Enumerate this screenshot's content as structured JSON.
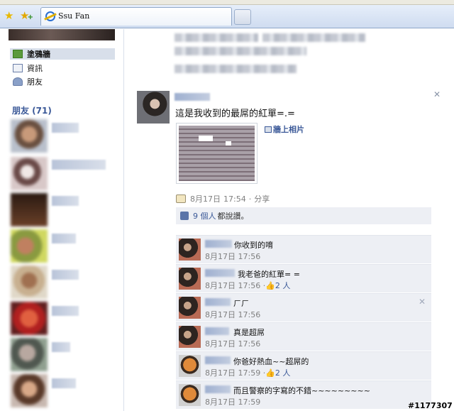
{
  "browser": {
    "tab_title": "Ssu Fan"
  },
  "sidebar": {
    "items": [
      {
        "label": "塗鴉牆"
      },
      {
        "label": "資訊"
      },
      {
        "label": "朋友"
      }
    ],
    "friends_heading": "朋友 (71)"
  },
  "post": {
    "text": "這是我收到的最屌的紅單=.=",
    "photo_link": "牆上相片",
    "date": "8月17日",
    "time": "17:54",
    "separator": "·",
    "share": "分享",
    "likes_count": "9 個人",
    "likes_suffix": "都說讚。"
  },
  "comments": [
    {
      "text": "你收到的唷",
      "date": "8月17日",
      "time": "17:56",
      "likes": ""
    },
    {
      "text": "我老爸的紅單= =",
      "date": "8月17日",
      "time": "17:56",
      "likes": "2 人"
    },
    {
      "text": "ㄏㄏ",
      "date": "8月17日",
      "time": "17:56",
      "likes": ""
    },
    {
      "text": "真是超屌",
      "date": "8月17日",
      "time": "17:56",
      "likes": ""
    },
    {
      "text": "你爸好熱血~~超屌的",
      "date": "8月17日",
      "time": "17:59",
      "likes": "2 人"
    },
    {
      "text": "而且警察的字寫的不錯~~~~~~~~~",
      "date": "8月17日",
      "time": "17:59",
      "likes": ""
    }
  ],
  "watermark": "#1177307"
}
